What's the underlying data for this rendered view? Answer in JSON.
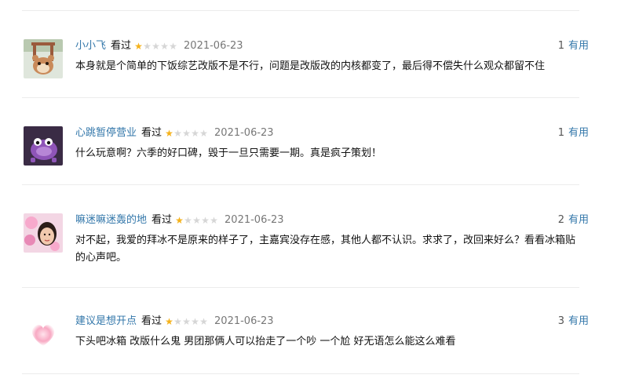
{
  "comments": [
    {
      "user": "小小飞",
      "status": "看过",
      "rating": 1,
      "date": "2021-06-23",
      "votes": "1",
      "vote_label": "有用",
      "text": "本身就是个简单的下饭综艺改版不是不行，问题是改版改的内核都变了，最后得不偿失什么观众都留不住"
    },
    {
      "user": "心跳暂停营业",
      "status": "看过",
      "rating": 1,
      "date": "2021-06-23",
      "votes": "1",
      "vote_label": "有用",
      "text": "什么玩意啊？六季的好口碑，毁于一旦只需要一期。真是疯子策划！"
    },
    {
      "user": "嘛迷嘛迷轰的地",
      "status": "看过",
      "rating": 1,
      "date": "2021-06-23",
      "votes": "2",
      "vote_label": "有用",
      "text": "对不起，我爱的拜冰不是原来的样子了，主嘉宾没存在感，其他人都不认识。求求了，改回来好么？看看冰箱贴的心声吧。"
    },
    {
      "user": "建议是想开点",
      "status": "看过",
      "rating": 1,
      "date": "2021-06-23",
      "votes": "3",
      "vote_label": "有用",
      "text": "下头吧冰箱 改版什么鬼 男团那俩人可以抬走了一个吵 一个尬 好无语怎么能这么难看"
    }
  ]
}
